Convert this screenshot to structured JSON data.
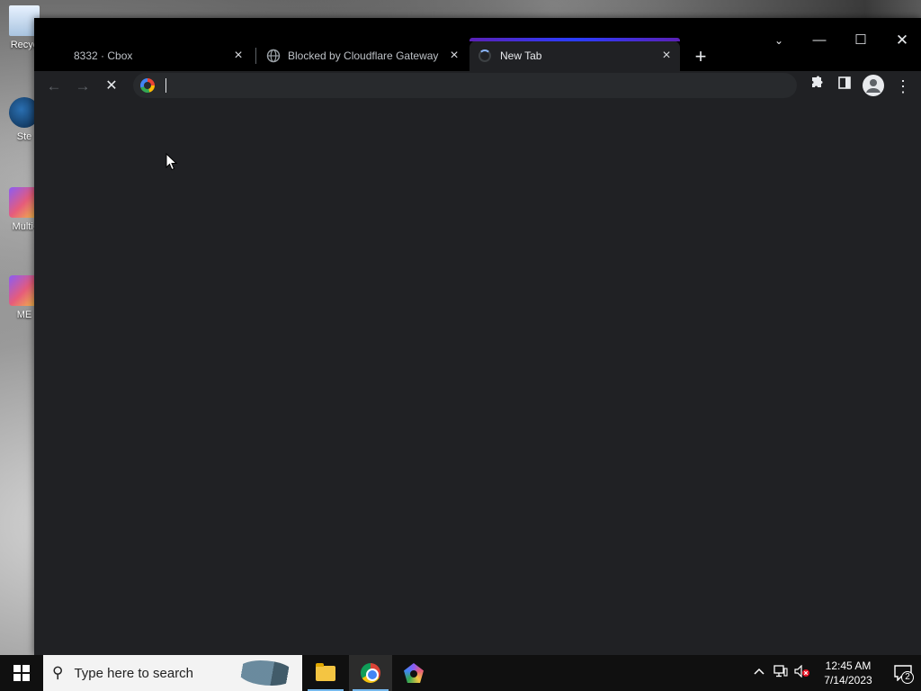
{
  "desktop": {
    "icons": [
      {
        "label": "Recyc",
        "icon": "recycle-bin-icon"
      },
      {
        "label": "Ste",
        "icon": "steam-icon"
      },
      {
        "label": "Multi-",
        "icon": "multi-app-icon"
      },
      {
        "label": "ME",
        "icon": "me-app-icon"
      }
    ]
  },
  "browser": {
    "tabs": [
      {
        "title": "8332 · Cbox",
        "close": "×",
        "active": false
      },
      {
        "title": "Blocked by Cloudflare Gateway",
        "close": "×",
        "active": false,
        "favicon": "globe-icon"
      },
      {
        "title": "New Tab",
        "close": "×",
        "active": true,
        "loading": true
      }
    ],
    "new_tab": "+",
    "window_controls": {
      "tab_search": "⌄",
      "minimize": "—",
      "maximize": "☐",
      "close": "✕"
    },
    "toolbar": {
      "back": "←",
      "forward": "→",
      "stop": "✕",
      "omnibox_value": "",
      "omnibox_placeholder": "",
      "extensions": "puzzle-icon",
      "side_panel": "side-panel-icon",
      "profile": "profile-icon",
      "menu": "⋮"
    },
    "accent_color": "#2a3dff"
  },
  "taskbar": {
    "search_placeholder": "Type here to search",
    "apps": [
      {
        "name": "File Explorer",
        "icon": "folder-icon",
        "active": false
      },
      {
        "name": "Google Chrome",
        "icon": "chrome-icon",
        "active": true
      },
      {
        "name": "App",
        "icon": "pentagon-app-icon",
        "active": false
      }
    ],
    "tray": {
      "chevron": "^",
      "network": "network-icon",
      "volume": "volume-muted-icon",
      "time": "12:45 AM",
      "date": "7/14/2023",
      "notifications": "2"
    }
  }
}
